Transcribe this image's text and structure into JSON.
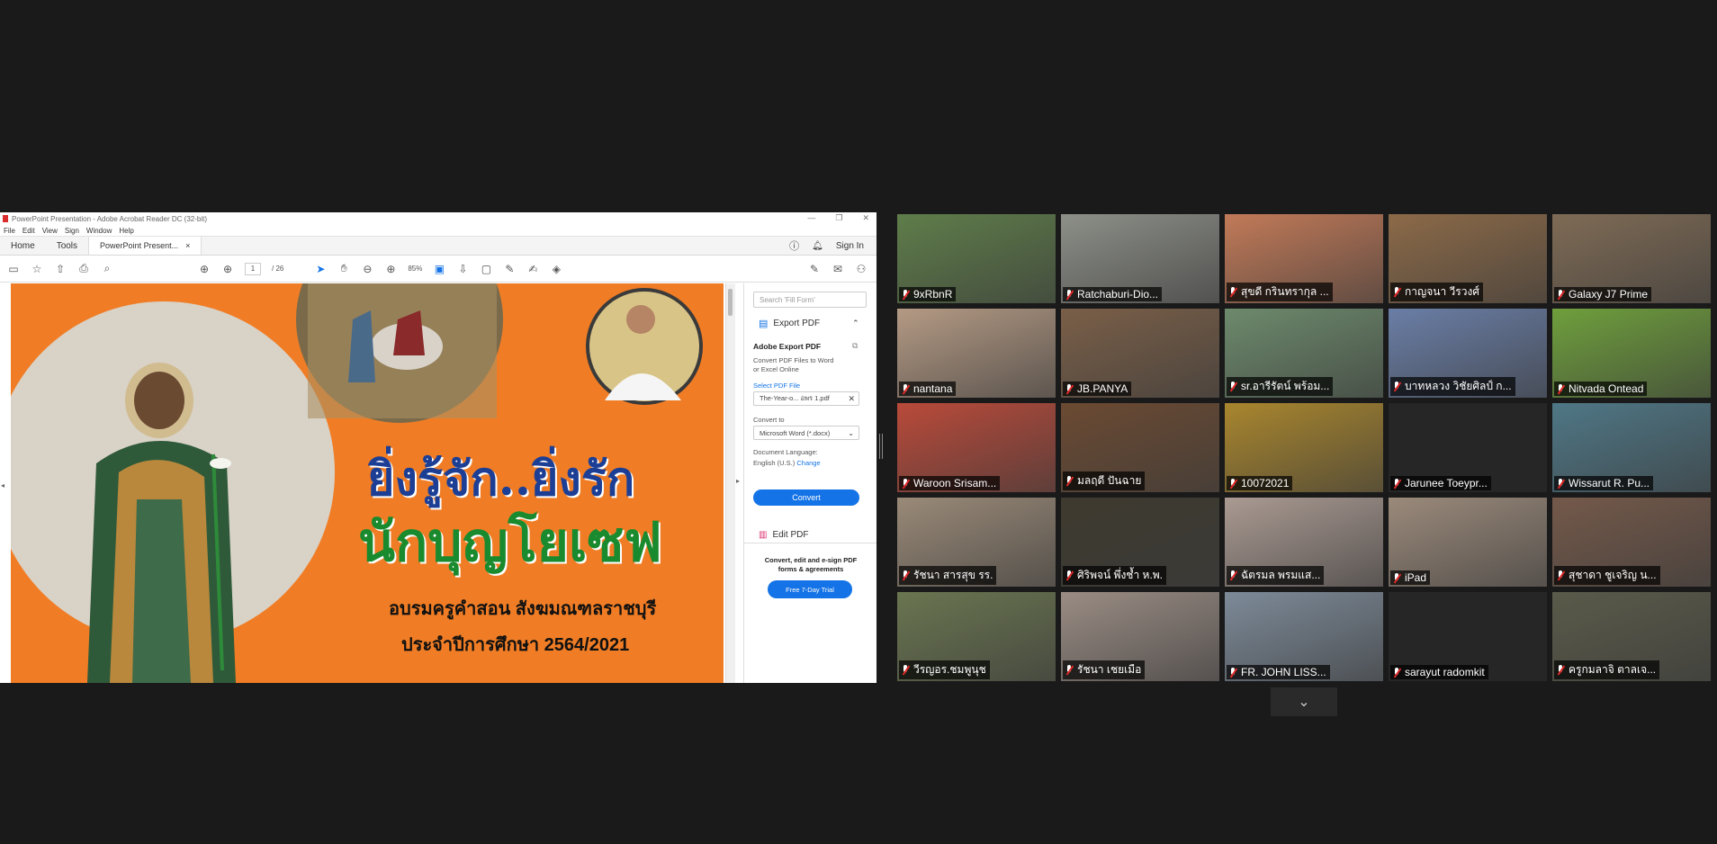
{
  "acrobat": {
    "title": "PowerPoint Presentation - Adobe Acrobat Reader DC (32-bit)",
    "menu": [
      "File",
      "Edit",
      "View",
      "Sign",
      "Window",
      "Help"
    ],
    "tabs": {
      "home": "Home",
      "tools": "Tools",
      "doc": "PowerPoint Present...",
      "close": "×"
    },
    "sign_in": "Sign In",
    "page_current": "1",
    "page_total": "/ 26",
    "zoom": "85%"
  },
  "slide": {
    "heading1": "ยิ่งรู้จัก..ยิ่งรัก",
    "heading2": "นักบุญโยเซฟ",
    "sub1": "อบรมครูคำสอน สังฆมณฑลราชบุรี",
    "sub2": "ประจำปีการศึกษา 2564/2021",
    "colors": {
      "bg": "#f07d25",
      "blue": "#1c3f95",
      "green": "#1a8a2e"
    }
  },
  "pane": {
    "search_placeholder": "Search 'Fill Form'",
    "export_label": "Export PDF",
    "adobe_export": "Adobe Export PDF",
    "convert_desc1": "Convert PDF Files to Word",
    "convert_desc2": "or Excel Online",
    "select_file": "Select PDF File",
    "file_name": "The-Year-o... อพร 1.pdf",
    "convert_to": "Convert to",
    "format": "Microsoft Word (*.docx)",
    "doc_lang": "Document Language:",
    "lang_value": "English (U.S.)",
    "change": "Change",
    "convert_btn": "Convert",
    "edit_pdf": "Edit PDF",
    "promo1": "Convert, edit and e-sign PDF",
    "promo2": "forms & agreements",
    "trial_btn": "Free 7-Day Trial"
  },
  "participants": [
    {
      "name": "9xRbnR",
      "color": "#5f7d4a"
    },
    {
      "name": "Ratchaburi-Dio...",
      "color": "#8d8f88"
    },
    {
      "name": "สุขดี กรินทรากุล ...",
      "color": "#c27a58"
    },
    {
      "name": "กาญจนา วีรวงศ์",
      "color": "#8c6a48"
    },
    {
      "name": "Galaxy J7 Prime",
      "color": "#7f6b55"
    },
    {
      "name": "nantana",
      "color": "#b49a84"
    },
    {
      "name": "JB.PANYA",
      "color": "#7a5f48"
    },
    {
      "name": "sr.อารีรัตน์ พร้อม...",
      "color": "#6d8a6c"
    },
    {
      "name": "บาทหลวง วิชัยศิลป์  ก...",
      "color": "#6a7ea6",
      "active": true
    },
    {
      "name": "Nitvada Ontead",
      "color": "#6f9f3c"
    },
    {
      "name": "Waroon Srisam...",
      "color": "#b94a3a"
    },
    {
      "name": "มลฤดี ปันฉาย",
      "color": "#6b4a32"
    },
    {
      "name": "10072021",
      "color": "#a9862e"
    },
    {
      "name": "Jarunee Toeypr...",
      "color": "#262626"
    },
    {
      "name": "Wissarut R. Pu...",
      "color": "#4f7786"
    },
    {
      "name": "รัชนา สารสุข รร.",
      "color": "#9a8a78"
    },
    {
      "name": "ศิริพจน์ พึ่งช้ำ ห.พ.",
      "color": "#3e3a2f"
    },
    {
      "name": "ฉัตรมล  พรมแส...",
      "color": "#aa9a92"
    },
    {
      "name": "iPad",
      "color": "#9b8a7b"
    },
    {
      "name": "สุชาดา ชูเจริญ น...",
      "color": "#74594a"
    },
    {
      "name": "วีรญอร.ชมพูนุช",
      "color": "#6a7550"
    },
    {
      "name": "รัชนา เชยเมือ",
      "color": "#9a8c84"
    },
    {
      "name": "FR. JOHN LISS...",
      "color": "#7d8a98"
    },
    {
      "name": "sarayut radomkit",
      "color": "#262626"
    },
    {
      "name": "ครูกมลาจิ ตาลเจ...",
      "color": "#5a5a4a"
    }
  ],
  "scroll_icon": "chevron-down-icon"
}
